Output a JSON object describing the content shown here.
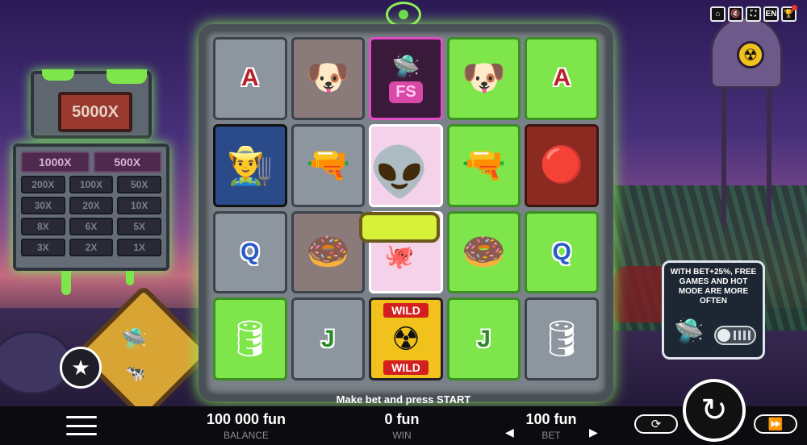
{
  "top_buttons": [
    {
      "label": "⌂",
      "icon": "home-icon"
    },
    {
      "label": "🔇",
      "icon": "sound-icon"
    },
    {
      "label": "⛶",
      "icon": "fullscreen-icon"
    },
    {
      "label": "EN",
      "icon": "language-icon"
    },
    {
      "label": "🏆",
      "icon": "trophy-icon"
    }
  ],
  "jackpot": {
    "main": "5000X",
    "rows": [
      [
        "1000X",
        "500X"
      ],
      [
        "200X",
        "100X",
        "50X"
      ],
      [
        "30X",
        "20X",
        "10X"
      ],
      [
        "8X",
        "6X",
        "5X"
      ],
      [
        "3X",
        "2X",
        "1X"
      ]
    ]
  },
  "reels": [
    [
      {
        "type": "letter",
        "text": "A",
        "bg": "grey"
      },
      {
        "type": "portrait",
        "symbol": "man-portrait"
      },
      {
        "type": "letter",
        "text": "Q",
        "bg": "grey"
      },
      {
        "type": "symbol",
        "symbol": "radioactive-barrel",
        "bg": "grey"
      }
    ],
    [
      {
        "type": "symbol",
        "symbol": "pug",
        "bg": "brown"
      },
      {
        "type": "symbol",
        "symbol": "ray-gun",
        "bg": "grey"
      },
      {
        "type": "symbol",
        "symbol": "donut",
        "bg": "brown"
      },
      {
        "type": "letter",
        "text": "J",
        "bg": "grey"
      }
    ],
    [
      {
        "type": "fs",
        "text": "FS"
      },
      {
        "type": "alien"
      },
      {
        "type": "alien"
      },
      {
        "type": "wild",
        "text_top": "WILD",
        "text_bottom": "WILD"
      }
    ],
    [
      {
        "type": "symbol",
        "symbol": "pug",
        "bg": "green"
      },
      {
        "type": "symbol",
        "symbol": "ray-gun",
        "bg": "green"
      },
      {
        "type": "symbol",
        "symbol": "donut",
        "bg": "green"
      },
      {
        "type": "letter",
        "text": "J",
        "bg": "green"
      }
    ],
    [
      {
        "type": "letter",
        "text": "A",
        "bg": "green"
      },
      {
        "type": "symbol",
        "symbol": "vault-wheel",
        "bg": "red"
      },
      {
        "type": "letter",
        "text": "Q",
        "bg": "green"
      },
      {
        "type": "symbol",
        "symbol": "radioactive-barrel",
        "bg": "grey"
      }
    ]
  ],
  "info_panel": {
    "text": "WITH BET+25%, FREE GAMES AND HOT MODE ARE MORE OFTEN",
    "toggle_on": false
  },
  "message": "Make bet and press START",
  "balance": {
    "value": "100 000 fun",
    "label": "BALANCE"
  },
  "win": {
    "value": "0 fun",
    "label": "WIN"
  },
  "bet": {
    "value": "100 fun",
    "label": "BET"
  },
  "controls": {
    "autoplay_icon": "autoplay-icon",
    "turbo_icon": "fast-forward-icon",
    "spin_icon": "spin-icon"
  },
  "colors": {
    "slime": "#7ee64b",
    "glow": "#8ef05a",
    "wild": "#f2c21c",
    "bar": "#0b0b10"
  }
}
